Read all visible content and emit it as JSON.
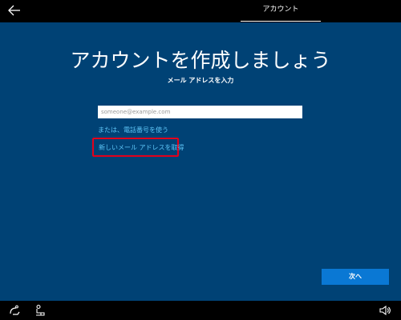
{
  "header": {
    "tab_label": "アカウント"
  },
  "main": {
    "title": "アカウントを作成しましょう",
    "subtitle": "メール アドレスを入力",
    "email_placeholder": "someone@example.com",
    "email_value": "",
    "phone_link": "または、電話番号を使う",
    "new_email_link": "新しいメール アドレスを取得",
    "next_label": "次へ"
  },
  "footer": {
    "icons": [
      "ease-of-access-icon",
      "accessibility-icon",
      "volume-icon"
    ]
  },
  "colors": {
    "background": "#004275",
    "bars": "#000000",
    "link": "#5ec6f7",
    "button": "#0a78d4",
    "highlight": "#e3001b"
  }
}
